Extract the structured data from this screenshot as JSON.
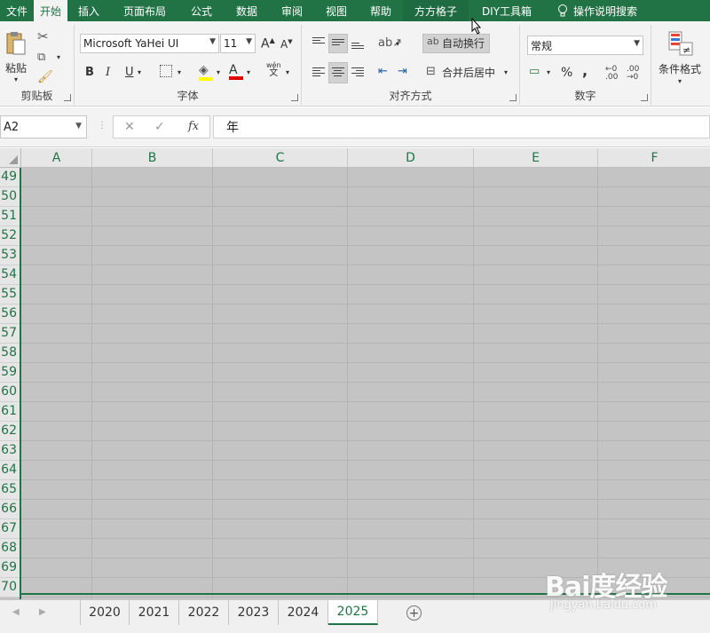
{
  "menubar": {
    "tabs": [
      {
        "label": "文件",
        "w": 38
      },
      {
        "label": "开始",
        "w": 38,
        "active": true
      },
      {
        "label": "插入",
        "w": 48
      },
      {
        "label": "页面布局",
        "w": 78
      },
      {
        "label": "公式",
        "w": 50
      },
      {
        "label": "数据",
        "w": 52
      },
      {
        "label": "审阅",
        "w": 50
      },
      {
        "label": "视图",
        "w": 50
      },
      {
        "label": "帮助",
        "w": 50
      },
      {
        "label": "方方格子",
        "w": 74,
        "dark": true
      },
      {
        "label": "DIY工具箱",
        "w": 86
      }
    ],
    "search_label": "操作说明搜索"
  },
  "ribbon": {
    "clipboard": {
      "paste_label": "粘贴",
      "group_label": "剪贴板"
    },
    "font": {
      "font_name": "Microsoft YaHei UI",
      "font_size": "11",
      "bold": "B",
      "italic": "I",
      "underline": "U",
      "phonetic_top": "wén",
      "phonetic_bottom": "文",
      "group_label": "字体"
    },
    "alignment": {
      "wrap_label": "自动换行",
      "merge_label": "合并后居中",
      "group_label": "对齐方式"
    },
    "number": {
      "format": "常规",
      "percent": "%",
      "comma": ",",
      "group_label": "数字"
    },
    "styles": {
      "conditional_label": "条件格式"
    }
  },
  "formula": {
    "namebox": "A2",
    "cancel": "✕",
    "enter": "✓",
    "fx": "fx",
    "content": "年"
  },
  "grid": {
    "columns": [
      "A",
      "B",
      "C",
      "D",
      "E",
      "F"
    ],
    "rows": [
      "49",
      "50",
      "51",
      "52",
      "53",
      "54",
      "55",
      "56",
      "57",
      "58",
      "59",
      "60",
      "61",
      "62",
      "63",
      "64",
      "65",
      "66",
      "67",
      "68",
      "69",
      "70"
    ]
  },
  "sheets": {
    "tabs": [
      "2020",
      "2021",
      "2022",
      "2023",
      "2024",
      "2025"
    ],
    "active": "2025",
    "add": "+"
  },
  "watermark": {
    "logo": "Bai度经验",
    "sub": "jingyan.baidu.com"
  },
  "colors": {
    "accent": "#217346",
    "selection": "#c4c4c4"
  }
}
